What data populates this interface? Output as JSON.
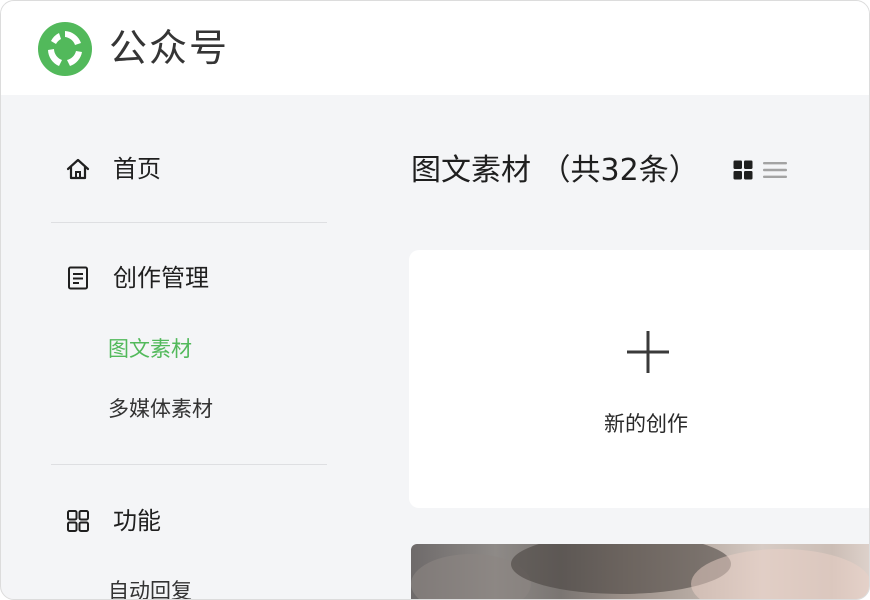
{
  "app": {
    "title": "公众号",
    "brand_color": "#52b95b"
  },
  "sidebar": {
    "home": {
      "label": "首页",
      "icon": "home-icon"
    },
    "creation": {
      "label": "创作管理",
      "icon": "document-icon",
      "items": [
        {
          "label": "图文素材",
          "active": true
        },
        {
          "label": "多媒体素材",
          "active": false
        }
      ]
    },
    "features": {
      "label": "功能",
      "icon": "grid-icon",
      "items": [
        {
          "label": "自动回复"
        }
      ]
    }
  },
  "main": {
    "title": "图文素材 （共32条）",
    "view_modes": [
      "grid-view-icon",
      "list-view-icon"
    ],
    "create_card": {
      "label": "新的创作",
      "icon": "plus-icon"
    }
  }
}
